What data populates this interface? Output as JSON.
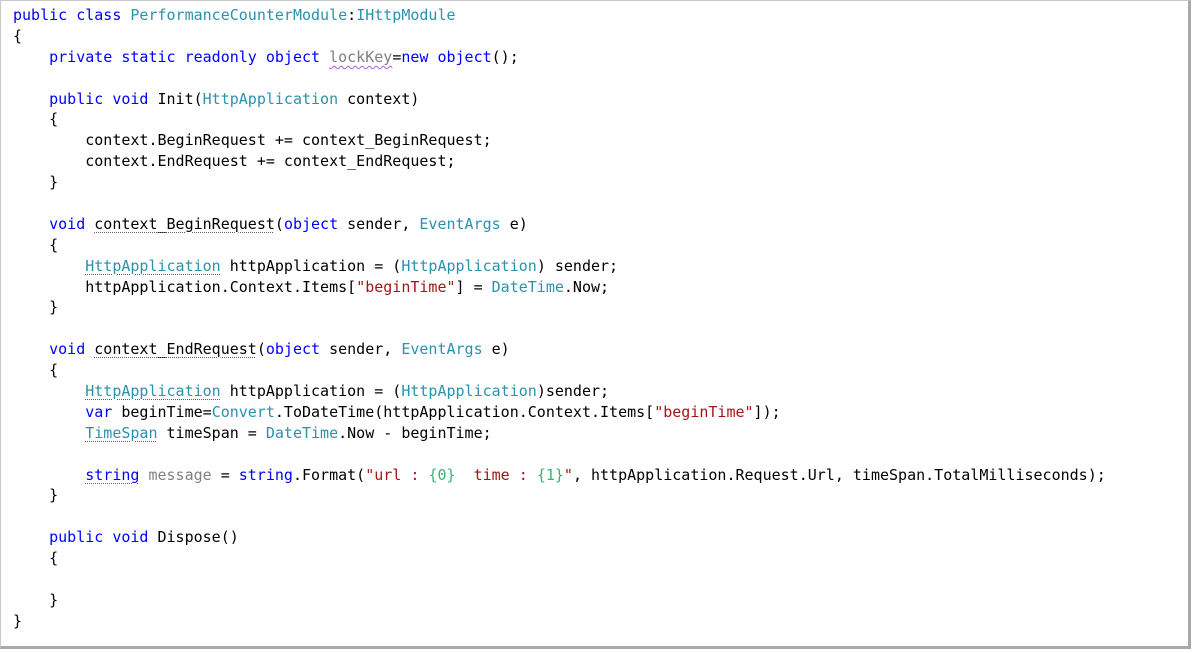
{
  "editor": {
    "lines": [
      {
        "tokens": [
          {
            "t": "public",
            "k": "kw"
          },
          {
            "t": " ",
            "k": "ws"
          },
          {
            "t": "class",
            "k": "kw"
          },
          {
            "t": " ",
            "k": "ws"
          },
          {
            "t": "PerformanceCounterModule",
            "k": "type"
          },
          {
            "t": ":",
            "k": "punc"
          },
          {
            "t": "IHttpModule",
            "k": "type"
          }
        ]
      },
      {
        "tokens": [
          {
            "t": "{",
            "k": "punc"
          }
        ]
      },
      {
        "tokens": [
          {
            "t": "    ",
            "k": "ws"
          },
          {
            "t": "private",
            "k": "kw"
          },
          {
            "t": " ",
            "k": "ws"
          },
          {
            "t": "static",
            "k": "kw"
          },
          {
            "t": " ",
            "k": "ws"
          },
          {
            "t": "readonly",
            "k": "kw"
          },
          {
            "t": " ",
            "k": "ws"
          },
          {
            "t": "object",
            "k": "kw"
          },
          {
            "t": " ",
            "k": "ws"
          },
          {
            "t": "lockKey",
            "k": "gray",
            "squiggle": "purple"
          },
          {
            "t": "=",
            "k": "punc"
          },
          {
            "t": "new",
            "k": "kw"
          },
          {
            "t": " ",
            "k": "ws"
          },
          {
            "t": "object",
            "k": "kw"
          },
          {
            "t": "();",
            "k": "punc"
          }
        ]
      },
      {
        "tokens": []
      },
      {
        "tokens": [
          {
            "t": "    ",
            "k": "ws"
          },
          {
            "t": "public",
            "k": "kw"
          },
          {
            "t": " ",
            "k": "ws"
          },
          {
            "t": "void",
            "k": "kw"
          },
          {
            "t": " ",
            "k": "ws"
          },
          {
            "t": "Init(",
            "k": "ident"
          },
          {
            "t": "HttpApplication",
            "k": "type"
          },
          {
            "t": " context)",
            "k": "ident"
          }
        ]
      },
      {
        "tokens": [
          {
            "t": "    ",
            "k": "ws"
          },
          {
            "t": "{",
            "k": "punc"
          }
        ]
      },
      {
        "tokens": [
          {
            "t": "        ",
            "k": "ws"
          },
          {
            "t": "context.BeginRequest += context_BeginRequest;",
            "k": "ident"
          }
        ]
      },
      {
        "tokens": [
          {
            "t": "        ",
            "k": "ws"
          },
          {
            "t": "context.EndRequest += context_EndRequest;",
            "k": "ident"
          }
        ]
      },
      {
        "tokens": [
          {
            "t": "    ",
            "k": "ws"
          },
          {
            "t": "}",
            "k": "punc"
          }
        ]
      },
      {
        "tokens": []
      },
      {
        "tokens": [
          {
            "t": "    ",
            "k": "ws"
          },
          {
            "t": "void",
            "k": "kw"
          },
          {
            "t": " ",
            "k": "ws"
          },
          {
            "t": "context_BeginRequest",
            "k": "ident",
            "squiggle": "dots"
          },
          {
            "t": "(",
            "k": "punc"
          },
          {
            "t": "object",
            "k": "kw"
          },
          {
            "t": " sender, ",
            "k": "ident"
          },
          {
            "t": "EventArgs",
            "k": "type"
          },
          {
            "t": " e)",
            "k": "ident"
          }
        ]
      },
      {
        "tokens": [
          {
            "t": "    ",
            "k": "ws"
          },
          {
            "t": "{",
            "k": "punc"
          }
        ]
      },
      {
        "tokens": [
          {
            "t": "        ",
            "k": "ws"
          },
          {
            "t": "HttpApplication",
            "k": "type",
            "squiggle": "dots"
          },
          {
            "t": " httpApplication = (",
            "k": "ident"
          },
          {
            "t": "HttpApplication",
            "k": "type"
          },
          {
            "t": ") sender;",
            "k": "ident"
          }
        ]
      },
      {
        "tokens": [
          {
            "t": "        ",
            "k": "ws"
          },
          {
            "t": "httpApplication.Context.Items[",
            "k": "ident"
          },
          {
            "t": "\"beginTime\"",
            "k": "str"
          },
          {
            "t": "] = ",
            "k": "ident"
          },
          {
            "t": "DateTime",
            "k": "type"
          },
          {
            "t": ".Now;",
            "k": "ident"
          }
        ]
      },
      {
        "tokens": [
          {
            "t": "    ",
            "k": "ws"
          },
          {
            "t": "}",
            "k": "punc"
          }
        ]
      },
      {
        "tokens": []
      },
      {
        "tokens": [
          {
            "t": "    ",
            "k": "ws"
          },
          {
            "t": "void",
            "k": "kw"
          },
          {
            "t": " ",
            "k": "ws"
          },
          {
            "t": "context_EndRequest",
            "k": "ident",
            "squiggle": "dots"
          },
          {
            "t": "(",
            "k": "punc"
          },
          {
            "t": "object",
            "k": "kw"
          },
          {
            "t": " sender, ",
            "k": "ident"
          },
          {
            "t": "EventArgs",
            "k": "type"
          },
          {
            "t": " e)",
            "k": "ident"
          }
        ]
      },
      {
        "tokens": [
          {
            "t": "    ",
            "k": "ws"
          },
          {
            "t": "{",
            "k": "punc"
          }
        ]
      },
      {
        "tokens": [
          {
            "t": "        ",
            "k": "ws"
          },
          {
            "t": "HttpApplication",
            "k": "type",
            "squiggle": "dots"
          },
          {
            "t": " httpApplication = (",
            "k": "ident"
          },
          {
            "t": "HttpApplication",
            "k": "type"
          },
          {
            "t": ")sender;",
            "k": "ident"
          }
        ]
      },
      {
        "tokens": [
          {
            "t": "        ",
            "k": "ws"
          },
          {
            "t": "var",
            "k": "kw"
          },
          {
            "t": " beginTime=",
            "k": "ident"
          },
          {
            "t": "Convert",
            "k": "type"
          },
          {
            "t": ".ToDateTime(httpApplication.Context.Items[",
            "k": "ident"
          },
          {
            "t": "\"beginTime\"",
            "k": "str"
          },
          {
            "t": "]);",
            "k": "ident"
          }
        ]
      },
      {
        "tokens": [
          {
            "t": "        ",
            "k": "ws"
          },
          {
            "t": "TimeSpan",
            "k": "type",
            "squiggle": "dots"
          },
          {
            "t": " timeSpan = ",
            "k": "ident"
          },
          {
            "t": "DateTime",
            "k": "type"
          },
          {
            "t": ".Now - beginTime;",
            "k": "ident"
          }
        ]
      },
      {
        "tokens": []
      },
      {
        "tokens": [
          {
            "t": "        ",
            "k": "ws"
          },
          {
            "t": "string",
            "k": "kw",
            "squiggle": "dots"
          },
          {
            "t": " ",
            "k": "ws"
          },
          {
            "t": "message",
            "k": "gray"
          },
          {
            "t": " = ",
            "k": "ident"
          },
          {
            "t": "string",
            "k": "kw"
          },
          {
            "t": ".Format(",
            "k": "ident"
          },
          {
            "t": "\"url : ",
            "k": "str"
          },
          {
            "t": "{0}",
            "k": "fmt"
          },
          {
            "t": "  time : ",
            "k": "str"
          },
          {
            "t": "{1}",
            "k": "fmt"
          },
          {
            "t": "\"",
            "k": "str"
          },
          {
            "t": ", httpApplication.Request.Url, timeSpan.TotalMilliseconds);",
            "k": "ident"
          }
        ]
      },
      {
        "tokens": [
          {
            "t": "    ",
            "k": "ws"
          },
          {
            "t": "}",
            "k": "punc"
          }
        ]
      },
      {
        "tokens": []
      },
      {
        "tokens": [
          {
            "t": "    ",
            "k": "ws"
          },
          {
            "t": "public",
            "k": "kw"
          },
          {
            "t": " ",
            "k": "ws"
          },
          {
            "t": "void",
            "k": "kw"
          },
          {
            "t": " ",
            "k": "ws"
          },
          {
            "t": "Dispose()",
            "k": "ident"
          }
        ]
      },
      {
        "tokens": [
          {
            "t": "    ",
            "k": "ws"
          },
          {
            "t": "{",
            "k": "punc"
          }
        ]
      },
      {
        "tokens": []
      },
      {
        "tokens": [
          {
            "t": "    ",
            "k": "ws"
          },
          {
            "t": "}",
            "k": "punc"
          }
        ]
      },
      {
        "tokens": [
          {
            "t": "}",
            "k": "punc"
          }
        ]
      }
    ]
  },
  "colors": {
    "keyword": "#0000ff",
    "type": "#2b91af",
    "string": "#a31515",
    "format_placeholder": "#3cb371",
    "unused_identifier": "#808080",
    "text": "#000000",
    "squiggle_warning": "#b05fd1",
    "squiggle_dots": "#606060"
  }
}
